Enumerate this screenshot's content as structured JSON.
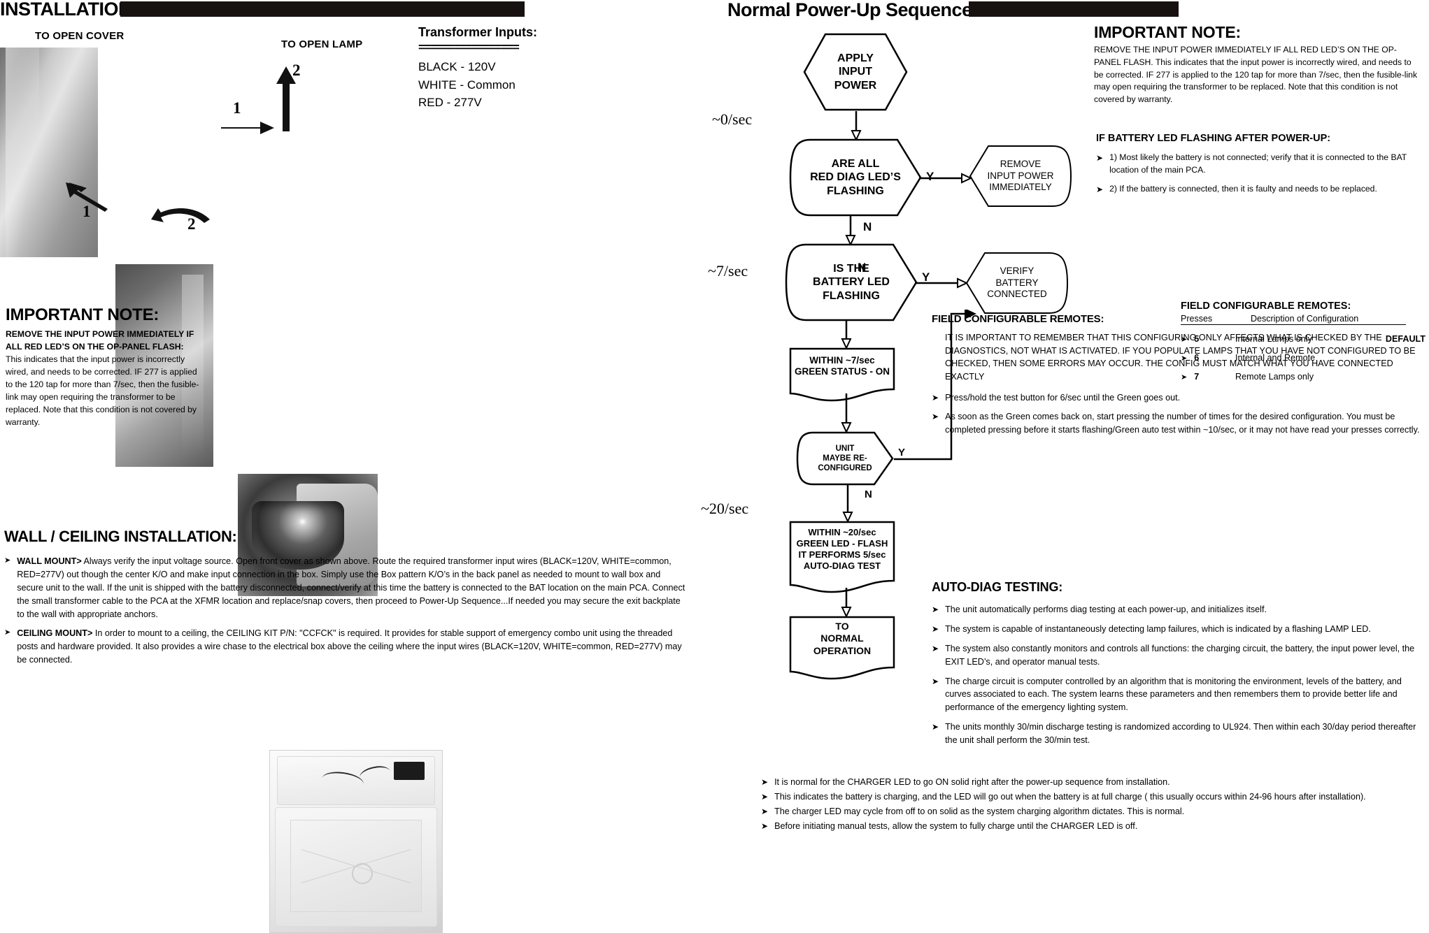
{
  "left": {
    "section_title": "INSTALLATION",
    "captions": {
      "open_cover": "TO OPEN COVER",
      "open_lamp": "TO OPEN LAMP"
    },
    "step_numbers": {
      "one": "1",
      "two": "2"
    },
    "transformer": {
      "title": "Transformer Inputs:",
      "rule": "=================",
      "lines": [
        "BLACK - 120V",
        "WHITE - Common",
        "RED - 277V"
      ]
    },
    "important_note": {
      "heading": "IMPORTANT NOTE:",
      "lead": "REMOVE THE INPUT POWER IMMEDIATELY IF ALL RED LED’S ON THE OP-PANEL FLASH:",
      "body": "  This indicates that the input power is incorrectly wired, and needs to be corrected.  IF 277 is applied to the 120 tap for more than 7/sec, then the fusible-link may open requiring the transformer to be replaced.  Note that this condition is not covered by warranty."
    },
    "wall_ceiling": {
      "heading": "WALL / CEILING INSTALLATION:",
      "items": [
        {
          "lead": "WALL MOUNT>",
          "body": " Always verify the input voltage source.  Open front cover as shown above.  Route the required transformer input wires (BLACK=120V, WHITE=common, RED=277V) out though the center K/O and make input connection in the box.   Simply use the Box pattern K/O’s in the back panel as needed to mount to wall box and secure unit to the wall.  If the unit is shipped with the battery disconnected, connect/verify at this time the battery is connected to the BAT location on the main PCA. Connect the small transformer cable to the PCA at the XFMR location and replace/snap covers, then proceed to Power-Up Sequence...If needed you may secure the exit backplate to the wall with appropriate anchors."
        },
        {
          "lead": "CEILING MOUNT>",
          "body": "  In order to mount to a ceiling, the CEILING KIT P/N: \"CCFCK\"  is required.  It provides for stable support of emergency combo unit using the threaded posts and hardware provided. It also provides a wire chase to the electrical box above the ceiling where the input wires  (BLACK=120V, WHITE=common, RED=277V) may be connected."
        }
      ]
    }
  },
  "right": {
    "section_title": "Normal Power-Up Sequence",
    "flow": {
      "nodes": {
        "apply": "APPLY\nINPUT\nPOWER",
        "red_diag": "ARE ALL\nRED DIAG LED’S\nFLASHING",
        "remove_power": "REMOVE\nINPUT POWER\nIMMEDIATELY",
        "battery_led": "IS THE\nBATTERY LED\nFLASHING",
        "verify_battery": "VERIFY\nBATTERY\nCONNECTED",
        "within7": "WITHIN ~7/sec\nGREEN STATUS - ON",
        "reconfig": "UNIT\nMAYBE RE-\nCONFIGURED",
        "within20": "WITHIN ~20/sec\nGREEN LED - FLASH\nIT PERFORMS 5/sec\nAUTO-DIAG TEST",
        "normal": "TO\nNORMAL\nOPERATION"
      },
      "edge_labels": {
        "y1": "Y",
        "n1": "N",
        "y2": "Y",
        "n2": "N",
        "y3": "Y",
        "n3": "N"
      },
      "time_labels": {
        "t0": "~0/sec",
        "t7": "~7/sec",
        "t20": "~20/sec"
      }
    },
    "important_note": {
      "heading": "IMPORTANT NOTE:",
      "body": "REMOVE THE INPUT POWER IMMEDIATELY IF ALL RED LED’S ON THE OP-PANEL FLASH.   This indicates that the input power is incorrectly wired, and needs to be corrected.  IF 277 is applied to the 120 tap for more than 7/sec, then the fusible-link may open requiring the transformer to be replaced.  Note that this condition is not covered by warranty."
    },
    "battery_flashing": {
      "heading": "IF BATTERY LED FLASHING AFTER POWER-UP:",
      "items": [
        "1)  Most likely the battery is not connected; verify that it is connected to the BAT location of the main PCA.",
        "2)  If the battery is connected, then it is faulty and needs to be replaced."
      ]
    },
    "remotes_table": {
      "heading": "FIELD CONFIGURABLE REMOTES:",
      "col_presses": "Presses",
      "col_desc": "Description of Configuration",
      "rows": [
        {
          "presses": "5",
          "desc": "Internal Lamps only",
          "flag": "DEFAULT"
        },
        {
          "presses": "6",
          "desc": "Internal and Remote",
          "flag": ""
        },
        {
          "presses": "7",
          "desc": "Remote Lamps only",
          "flag": ""
        }
      ]
    },
    "remotes_info": {
      "heading": "FIELD CONFIGURABLE REMOTES:",
      "paragraph": "IT IS IMPORTANT TO REMEMBER THAT THIS CONFIGURING ONLY AFFECTS WHAT IS CHECKED BY THE DIAGNOSTICS, NOT WHAT IS ACTIVATED.  IF YOU POPULATE LAMPS THAT YOU HAVE NOT CONFIGURED TO BE CHECKED, THEN SOME ERRORS MAY OCCUR.  THE CONFIG MUST MATCH WHAT YOU HAVE CONNECTED EXACTLY",
      "items": [
        "Press/hold the test button for 6/sec until the Green goes out.",
        "As soon as the Green comes back on, start pressing the number of times for the desired configuration.  You must be completed pressing before it starts flashing/Green auto test within ~10/sec, or it may not have read your presses correctly."
      ]
    },
    "auto_diag": {
      "heading": "AUTO-DIAG TESTING:",
      "items": [
        "The unit automatically performs diag testing at each power-up, and initializes itself.",
        "The system is capable of instantaneously detecting lamp failures, which is indicated by a flashing LAMP LED.",
        "The system also constantly monitors and controls all functions:  the charging circuit, the battery, the input power level, the EXIT LED’s, and operator manual tests.",
        "The charge circuit is computer controlled by an algorithm that is monitoring the environment, levels of the battery, and curves associated to each.  The system learns these parameters and then remembers them  to provide better life and performance of the emergency lighting system.",
        "The units monthly 30/min discharge testing is randomized according to UL924.  Then within each 30/day period thereafter the unit shall perform the 30/min test."
      ]
    },
    "charger_notes": [
      "It is normal for the CHARGER LED to go ON solid right after the power-up sequence from installation.",
      "This indicates the battery is charging, and the LED will go out when the battery is at full charge ( this usually occurs within 24-96 hours after installation).",
      "The charger LED may cycle from off to on solid as the system charging algorithm dictates.  This is normal.",
      "Before initiating manual tests, allow  the system to fully charge until the CHARGER LED is off."
    ]
  },
  "icons": {
    "bullet_arrow": "➤"
  },
  "colors": {
    "bar": "#17120f",
    "text": "#000000",
    "paper": "#ffffff"
  }
}
